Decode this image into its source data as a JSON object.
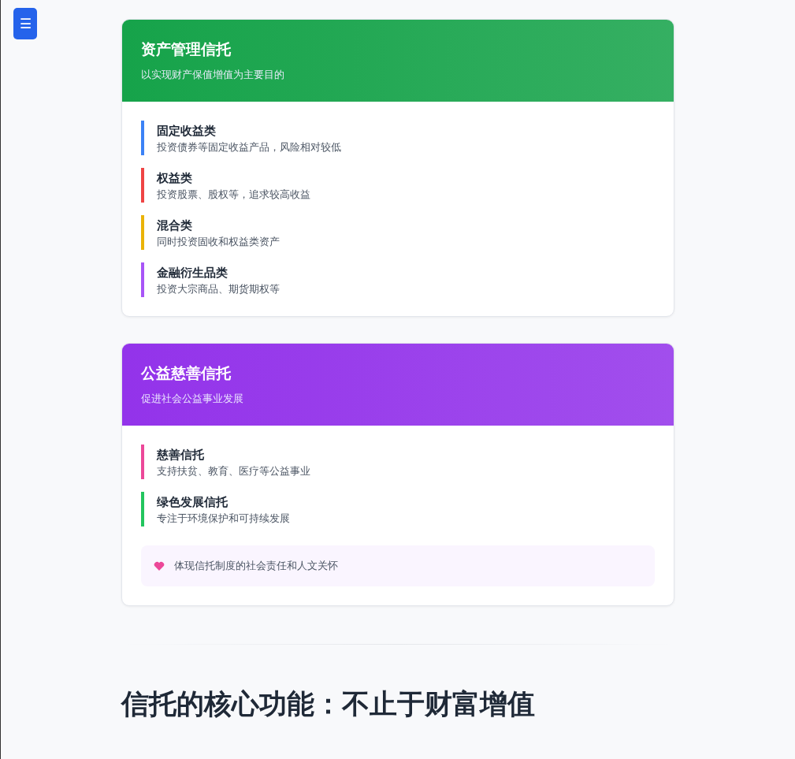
{
  "menu_button": {
    "label": "☰"
  },
  "cards": [
    {
      "title": "资产管理信托",
      "subtitle": "以实现财产保值增值为主要目的",
      "color": "#16a34a",
      "items": [
        {
          "title": "固定收益类",
          "description": "投资债券等固定收益产品，风险相对较低",
          "color": "#3b82f6"
        },
        {
          "title": "权益类",
          "description": "投资股票、股权等，追求较高收益",
          "color": "#ef4444"
        },
        {
          "title": "混合类",
          "description": "同时投资固收和权益类资产",
          "color": "#eab308"
        },
        {
          "title": "金融衍生品类",
          "description": "投资大宗商品、期货期权等",
          "color": "#a855f7"
        }
      ]
    },
    {
      "title": "公益慈善信托",
      "subtitle": "促进社会公益事业发展",
      "color": "#9333ea",
      "items": [
        {
          "title": "慈善信托",
          "description": "支持扶贫、教育、医疗等公益事业",
          "color": "#ec4899"
        },
        {
          "title": "绿色发展信托",
          "description": "专注于环境保护和可持续发展",
          "color": "#22c55e"
        }
      ],
      "note": "体现信托制度的社会责任和人文关怀"
    }
  ],
  "section_heading": "信托的核心功能：不止于财富增值"
}
